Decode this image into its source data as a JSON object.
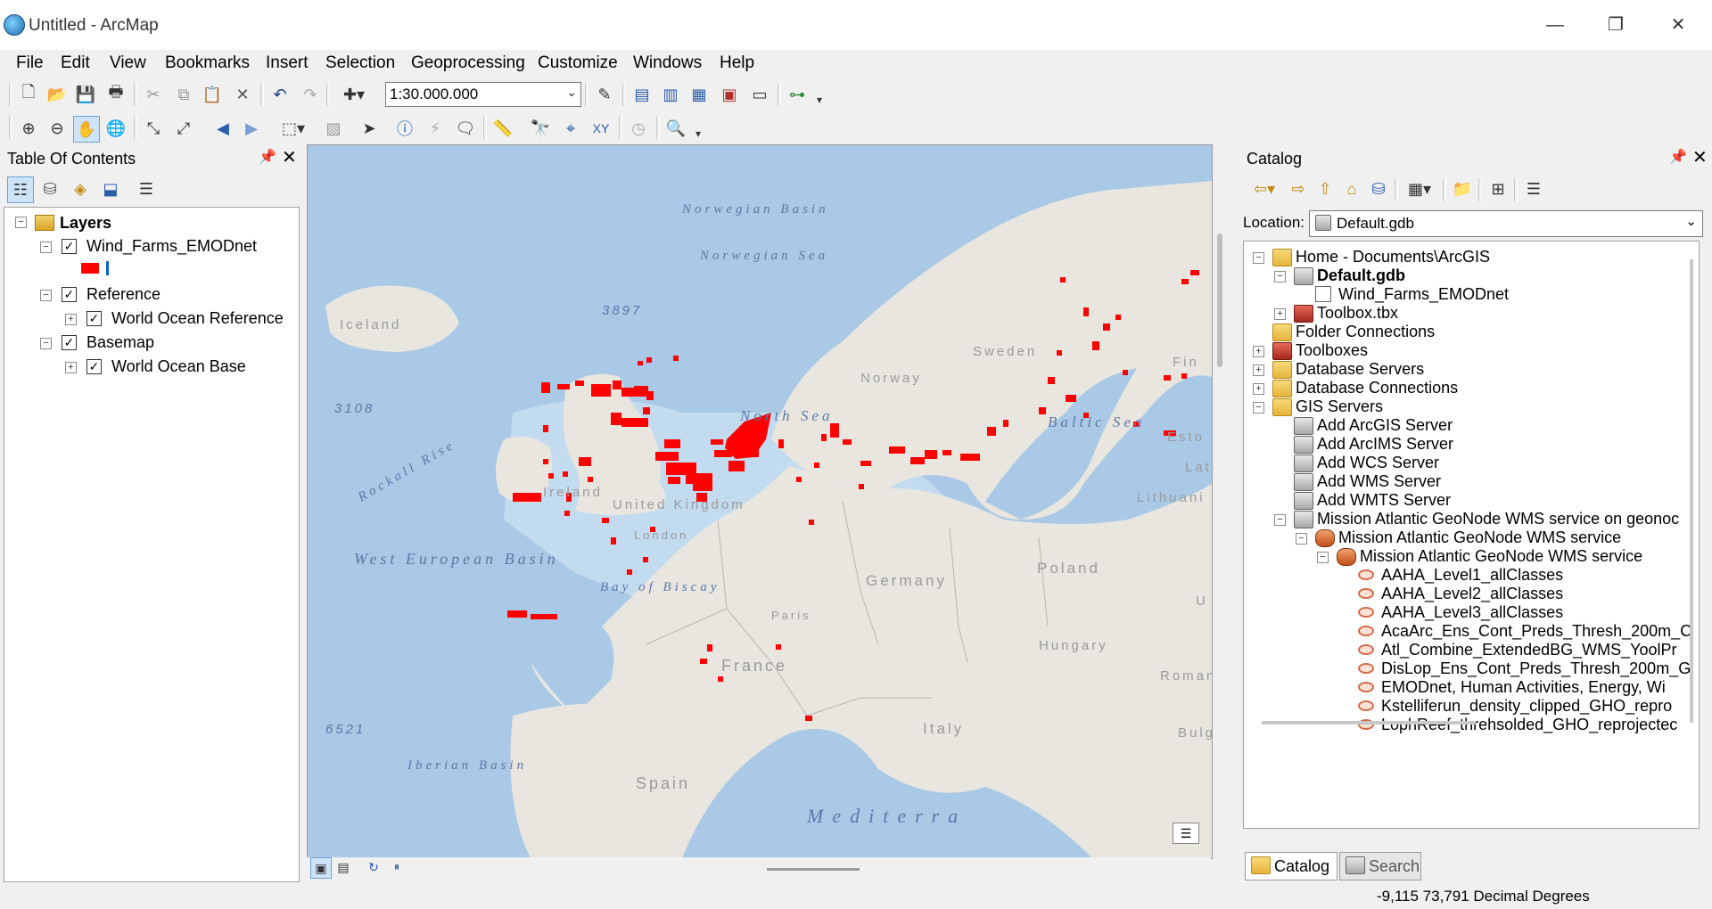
{
  "window": {
    "title": "Untitled - ArcMap",
    "minimize": "—",
    "maximize": "❐",
    "close": "✕"
  },
  "menu": [
    "File",
    "Edit",
    "View",
    "Bookmarks",
    "Insert",
    "Selection",
    "Geoprocessing",
    "Customize",
    "Windows",
    "Help"
  ],
  "toolbar": {
    "scale": "1:30.000.000"
  },
  "toc": {
    "title": "Table Of Contents",
    "layers_root": "Layers",
    "items": [
      {
        "label": "Wind_Farms_EMODnet",
        "checked": true
      },
      {
        "label": "Reference",
        "checked": true
      },
      {
        "label": "World Ocean Reference",
        "checked": true
      },
      {
        "label": "Basemap",
        "checked": true
      },
      {
        "label": "World Ocean Base",
        "checked": true
      }
    ],
    "symbol_color": "#ff0000"
  },
  "map": {
    "labels": {
      "norwegian_basin": "Norwegian Basin",
      "norwegian_sea": "Norwegian Sea",
      "iceland": "Iceland",
      "depth_3897": "3897",
      "depth_3108": "3108",
      "rockall_rise": "Rockall Rise",
      "north_sea": "North Sea",
      "ireland": "Ireland",
      "united_kingdom": "United Kingdom",
      "london": "London",
      "norway": "Norway",
      "sweden": "Sweden",
      "fin": "Fin",
      "esto": "Esto",
      "lat": "Lat",
      "baltic_sea": "Baltic Sea",
      "lithuania": "Lithuani",
      "poland": "Poland",
      "germany": "Germany",
      "u": "U",
      "paris": "Paris",
      "france": "France",
      "hungary": "Hungary",
      "roman": "Roman",
      "bulga": "Bulga",
      "italy": "Italy",
      "west_european_basin": "West European Basin",
      "bay_of_biscay": "Bay of Biscay",
      "depth_6521": "6521",
      "iberian_basin": "Iberian Basin",
      "spain": "Spain",
      "mediterranean": "Mediterra"
    },
    "colors": {
      "ocean": "#a9c9e6",
      "land": "#e8e6df",
      "windfarm": "#ff0000"
    }
  },
  "catalog": {
    "title": "Catalog",
    "location_label": "Location:",
    "location_value": "Default.gdb",
    "tree": [
      {
        "label": "Home - Documents\\ArcGIS"
      },
      {
        "label": "Default.gdb"
      },
      {
        "label": "Wind_Farms_EMODnet"
      },
      {
        "label": "Toolbox.tbx"
      },
      {
        "label": "Folder Connections"
      },
      {
        "label": "Toolboxes"
      },
      {
        "label": "Database Servers"
      },
      {
        "label": "Database Connections"
      },
      {
        "label": "GIS Servers"
      },
      {
        "label": "Add ArcGIS Server"
      },
      {
        "label": "Add ArcIMS Server"
      },
      {
        "label": "Add WCS Server"
      },
      {
        "label": "Add WMS Server"
      },
      {
        "label": "Add WMTS Server"
      },
      {
        "label": "Mission Atlantic GeoNode WMS service on geonoc"
      },
      {
        "label": "Mission Atlantic GeoNode WMS service"
      },
      {
        "label": "Mission Atlantic GeoNode WMS service"
      },
      {
        "label": "AAHA_Level1_allClasses"
      },
      {
        "label": "AAHA_Level2_allClasses"
      },
      {
        "label": "AAHA_Level3_allClasses"
      },
      {
        "label": "AcaArc_Ens_Cont_Preds_Thresh_200m_C"
      },
      {
        "label": "Atl_Combine_ExtendedBG_WMS_YoolPr"
      },
      {
        "label": "DisLop_Ens_Cont_Preds_Thresh_200m_G"
      },
      {
        "label": "EMODnet, Human Activities, Energy, Wi"
      },
      {
        "label": "Kstelliferun_density_clipped_GHO_repro"
      },
      {
        "label": "LophReef_threhsolded_GHO_reprojectec"
      }
    ],
    "tabs": {
      "catalog": "Catalog",
      "search": "Search"
    }
  },
  "status": {
    "coordinates": "-9,115  73,791 Decimal Degrees"
  }
}
